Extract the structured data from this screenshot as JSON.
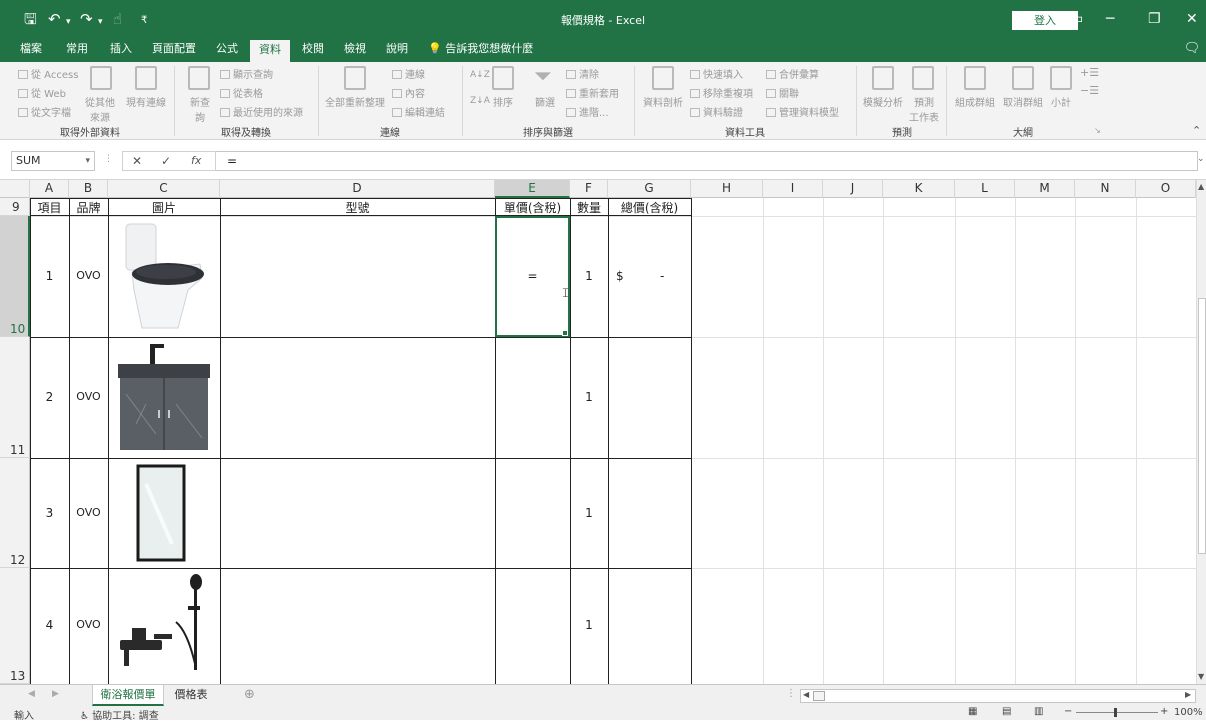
{
  "title_bar": {
    "doc_title": "報價規格 - Excel",
    "login": "登入",
    "qat_customize": "₹"
  },
  "tabs": [
    "檔案",
    "常用",
    "插入",
    "頁面配置",
    "公式",
    "資料",
    "校閱",
    "檢視",
    "說明"
  ],
  "tell_me": "告訴我您想做什麼",
  "ribbon": {
    "get_external": {
      "items": [
        "從 Access",
        "從 Web",
        "從文字檔"
      ],
      "from_other": "從其他\n來源",
      "existing": "現有連線",
      "label": "取得外部資料"
    },
    "get_transform": {
      "new_query": "新查\n詢",
      "items": [
        "顯示查詢",
        "從表格",
        "最近使用的來源"
      ],
      "label": "取得及轉換"
    },
    "connections": {
      "refresh_all": "全部重新整理",
      "items": [
        "連線",
        "內容",
        "編輯連結"
      ],
      "label": "連線"
    },
    "sort_filter": {
      "sort": "排序",
      "filter": "篩選",
      "items": [
        "清除",
        "重新套用",
        "進階..."
      ],
      "label": "排序與篩選"
    },
    "data_tools": {
      "text_to_cols": "資料剖析",
      "items_a": [
        "快速填入",
        "移除重複項",
        "資料驗證"
      ],
      "items_b": [
        "合併彙算",
        "關聯",
        "管理資料模型"
      ],
      "label": "資料工具"
    },
    "forecast": {
      "what_if": "模擬分析",
      "sheet": "預測\n工作表",
      "label": "預測"
    },
    "outline": {
      "group": "組成群組",
      "ungroup": "取消群組",
      "subtotal": "小計",
      "label": "大綱"
    }
  },
  "formula_bar": {
    "name_box": "SUM",
    "cancel": "✕",
    "enter": "✓",
    "fx": "fx",
    "value": "="
  },
  "columns": [
    "A",
    "B",
    "C",
    "D",
    "E",
    "F",
    "G",
    "H",
    "I",
    "J",
    "K",
    "L",
    "M",
    "N",
    "O"
  ],
  "rows": [
    "9",
    "10",
    "11",
    "12",
    "13"
  ],
  "header_row": {
    "a": "項目",
    "b": "品牌",
    "c": "圖片",
    "d": "型號",
    "e": "單價(含稅)",
    "f": "數量",
    "g": "總價(含稅)"
  },
  "items": [
    {
      "no": "1",
      "brand": "OVO",
      "qty": "1",
      "price": "=",
      "total_sym": "$",
      "total_val": "-",
      "image": "toilet-image"
    },
    {
      "no": "2",
      "brand": "OVO",
      "qty": "1",
      "image": "vanity-cabinet-image"
    },
    {
      "no": "3",
      "brand": "OVO",
      "qty": "1",
      "image": "mirror-image"
    },
    {
      "no": "4",
      "brand": "OVO",
      "qty": "1",
      "image": "shower-faucet-image"
    }
  ],
  "sheets": [
    "衛浴報價單",
    "價格表"
  ],
  "status": {
    "mode": "輸入",
    "accessibility": "協助工具: 調查",
    "zoom": "100%"
  },
  "colors": {
    "accent": "#217346"
  }
}
